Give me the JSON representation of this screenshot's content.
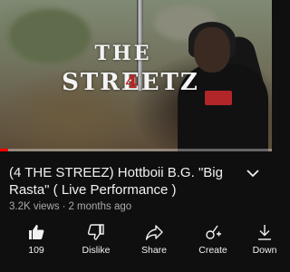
{
  "video": {
    "overlay_logo_line1": "THE",
    "overlay_logo_line2": "STREETZ",
    "overlay_logo_mark": "4",
    "progress_fraction": 0.03
  },
  "details": {
    "title": "(4 THE STREEZ) Hottboii B.G. \"Big Rasta\" ( Live Performance )",
    "views": "3.2K views",
    "separator": "·",
    "age": "2 months ago"
  },
  "actions": [
    {
      "icon": "thumbs-up-icon",
      "label": "109"
    },
    {
      "icon": "thumbs-down-icon",
      "label": "Dislike"
    },
    {
      "icon": "share-icon",
      "label": "Share"
    },
    {
      "icon": "create-icon",
      "label": "Create"
    },
    {
      "icon": "download-icon",
      "label": "Down"
    }
  ],
  "colors": {
    "background": "#0f0f0f",
    "progress": "#ff0000",
    "secondary_text": "#aaaaaa"
  }
}
